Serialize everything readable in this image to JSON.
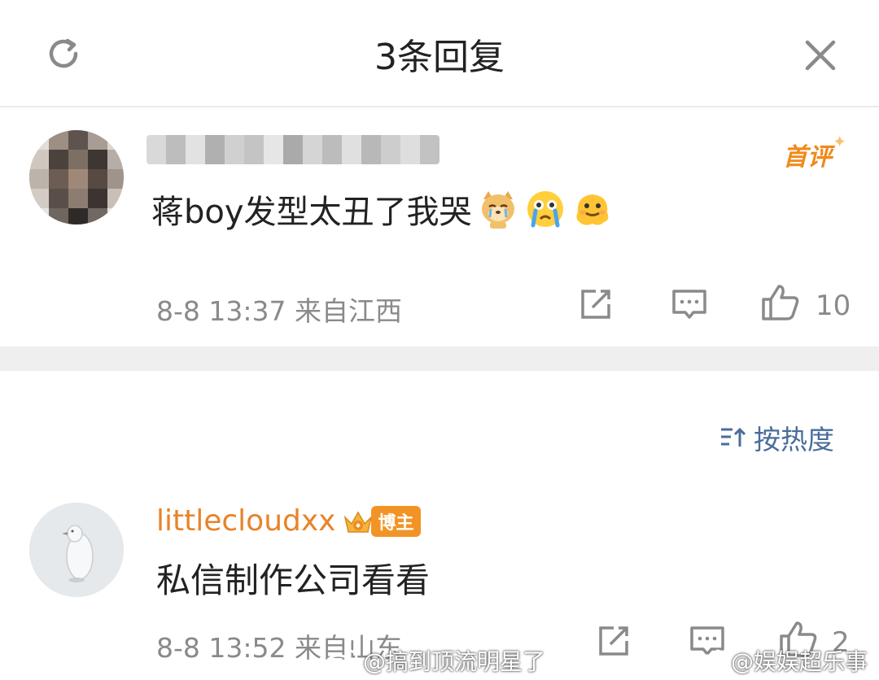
{
  "header": {
    "title": "3条回复"
  },
  "comment1": {
    "badge": "首评",
    "text": "蒋boy发型太丑了我哭",
    "emojis": [
      "doge-cry-emoji",
      "crying-face-emoji",
      "melting-face-emoji"
    ],
    "timestamp": "8-8 13:37",
    "location": "来自江西",
    "like_count": "10"
  },
  "sort": {
    "label": "按热度"
  },
  "comment2": {
    "username": "littlecloudxx",
    "badge": "博主",
    "text": "私信制作公司看看",
    "timestamp": "8-8 13:52",
    "location": "来自山东",
    "like_count": "2"
  },
  "watermarks": {
    "left": "@搞到顶流明星了",
    "right": "@娱娱超乐事"
  },
  "colors": {
    "username_orange": "#e8832a",
    "sort_blue": "#4a6c9b",
    "meta_gray": "#8a8a8a",
    "badge_orange": "#f29425"
  }
}
